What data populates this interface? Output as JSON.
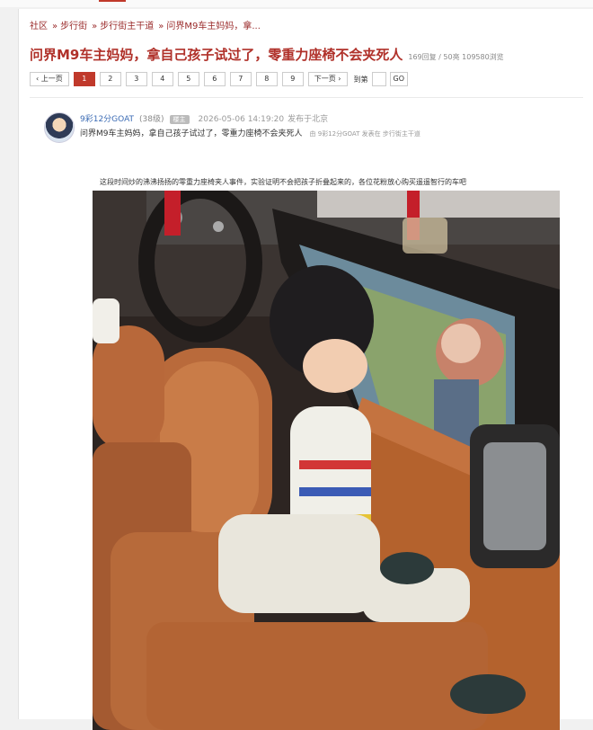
{
  "breadcrumb": [
    "社区",
    "步行街",
    "步行街主干道",
    "问界M9车主妈妈，拿..."
  ],
  "breadcrumb_sep": "»",
  "thread": {
    "title": "问界M9车主妈妈，拿自己孩子试过了，零重力座椅不会夹死人",
    "stats": "169回复 / 50亮 109580浏览"
  },
  "pager": {
    "prev": "‹ 上一页",
    "pages": [
      "1",
      "2",
      "3",
      "4",
      "5",
      "6",
      "7",
      "8",
      "9"
    ],
    "current": "1",
    "next": "下一页 ›",
    "jump_label": "到第",
    "go": "GO"
  },
  "post": {
    "author": "9彩12分GOAT",
    "level": "(38级)",
    "badge": "楼主",
    "time": "2026-05-06 14:19:20",
    "location": "发布于北京",
    "subject": "问界M9车主妈妈，拿自己孩子试过了，零重力座椅不会夹死人",
    "meta_by": "由",
    "meta_author": "9彩12分GOAT",
    "meta_posted": "发表在",
    "meta_board": "步行街主干道",
    "body": "这段时间炒的沸沸扬扬的零重力座椅夹人事件，实验证明不会把孩子折叠起来的，各位花粉放心购买遥遥智行的车吧",
    "image_description_icon": "photo-icon"
  },
  "colors": {
    "accent": "#c0392b",
    "link": "#3b6bb4",
    "title": "#b0312a"
  }
}
